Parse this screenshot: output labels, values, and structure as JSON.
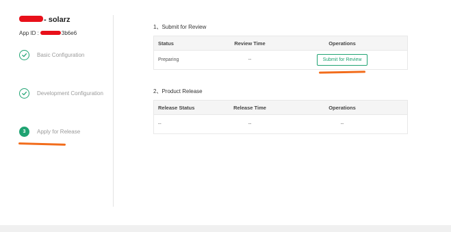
{
  "app": {
    "name_suffix": "- solarz",
    "id_label": "App ID :",
    "id_suffix": "3b6e6"
  },
  "steps": [
    {
      "label": "Basic Configuration",
      "status": "done"
    },
    {
      "label": "Development Configuration",
      "status": "done"
    },
    {
      "label": "Apply for Release",
      "status": "current",
      "number": "3"
    }
  ],
  "review": {
    "title": "1、Submit for Review",
    "columns": [
      "Status",
      "Review Time",
      "Operations"
    ],
    "row": {
      "status": "Preparing",
      "time": "--",
      "action": "Submit for Review"
    }
  },
  "release": {
    "title": "2、Product Release",
    "columns": [
      "Release Status",
      "Release Time",
      "Operations"
    ],
    "row": {
      "status": "--",
      "time": "--",
      "operation": "--"
    }
  },
  "colors": {
    "accent": "#1fa372",
    "annotation": "#f26c1b",
    "redaction": "#e8101a"
  }
}
